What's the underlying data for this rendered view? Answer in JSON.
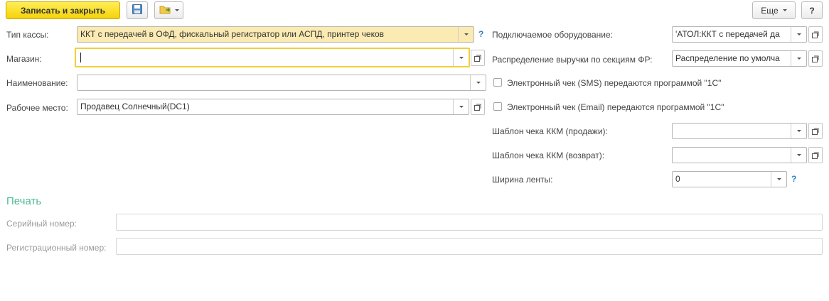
{
  "toolbar": {
    "save_close_label": "Записать и закрыть",
    "save_icon": "floppy-disk-icon",
    "create_based_icon": "folder-arrow-icon",
    "more_label": "Еще",
    "help_label": "?"
  },
  "left": {
    "kassa_type": {
      "label": "Тип кассы:",
      "value": "ККТ с передачей в ОФД, фискальный регистратор или АСПД, принтер чеков",
      "help": "?"
    },
    "store": {
      "label": "Магазин:",
      "value": ""
    },
    "name": {
      "label": "Наименование:",
      "value": ""
    },
    "workplace": {
      "label": "Рабочее место:",
      "value": "Продавец Солнечный(DC1)"
    }
  },
  "right": {
    "equipment": {
      "label": "Подключаемое оборудование:",
      "value": "'АТОЛ:ККТ с передачей да"
    },
    "revenue": {
      "label": "Распределение выручки по секциям ФР:",
      "value": "Распределение по умолча"
    },
    "sms_check": {
      "label": "Электронный чек (SMS) передаются программой \"1С\"",
      "checked": false
    },
    "email_check": {
      "label": "Электронный чек (Email) передаются программой \"1С\"",
      "checked": false
    },
    "template_sale": {
      "label": "Шаблон чека ККМ (продажи):",
      "value": ""
    },
    "template_return": {
      "label": "Шаблон чека ККМ (возврат):",
      "value": ""
    },
    "tape_width": {
      "label": "Ширина ленты:",
      "value": "0",
      "help": "?"
    }
  },
  "print": {
    "title": "Печать",
    "serial": {
      "label": "Серийный номер:",
      "value": ""
    },
    "reg": {
      "label": "Регистрационный номер:",
      "value": ""
    }
  },
  "colors": {
    "accent_yellow": "#f5d20a",
    "section_green": "#4db894",
    "help_blue": "#2d83c7"
  }
}
